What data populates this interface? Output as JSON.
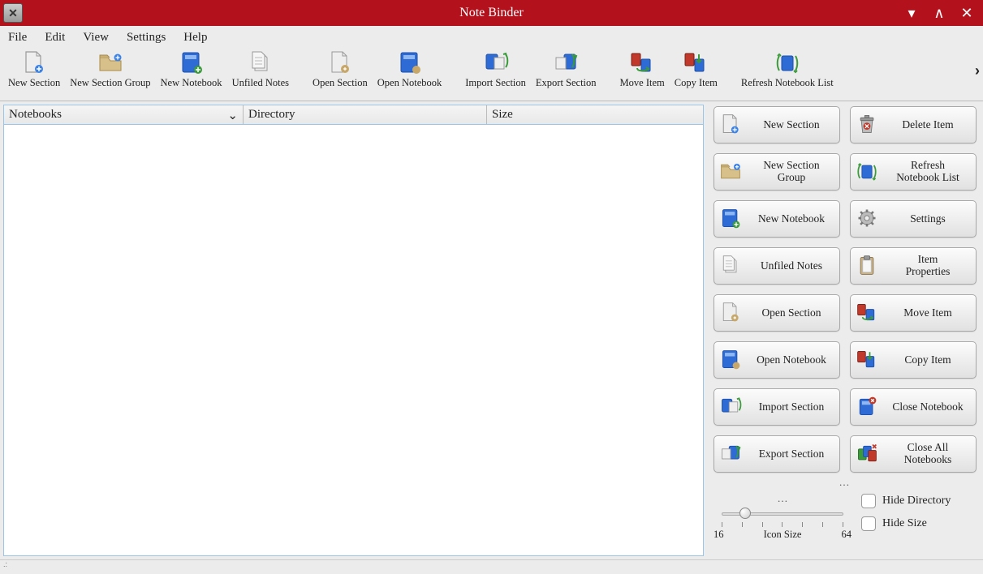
{
  "titlebar": {
    "title": "Note Binder"
  },
  "menubar": [
    "File",
    "Edit",
    "View",
    "Settings",
    "Help"
  ],
  "toolbar": {
    "groups": [
      [
        {
          "id": "new-section",
          "label": "New Section",
          "icon": "file-plus-gray"
        },
        {
          "id": "new-section-group",
          "label": "New Section Group",
          "icon": "folder-plus"
        },
        {
          "id": "new-notebook",
          "label": "New Notebook",
          "icon": "notebook-blue-plus"
        },
        {
          "id": "unfiled-notes",
          "label": "Unfiled Notes",
          "icon": "file-gray-stack"
        }
      ],
      [
        {
          "id": "open-section",
          "label": "Open Section",
          "icon": "file-gray-open"
        },
        {
          "id": "open-notebook",
          "label": "Open Notebook",
          "icon": "notebook-blue-open"
        }
      ],
      [
        {
          "id": "import-section",
          "label": "Import Section",
          "icon": "import-arrow"
        },
        {
          "id": "export-section",
          "label": "Export Section",
          "icon": "export-arrow"
        }
      ],
      [
        {
          "id": "move-item",
          "label": "Move Item",
          "icon": "move-book"
        },
        {
          "id": "copy-item",
          "label": "Copy Item",
          "icon": "copy-book"
        }
      ],
      [
        {
          "id": "refresh-notebook-list",
          "label": "Refresh Notebook List",
          "icon": "refresh-book"
        }
      ]
    ]
  },
  "columns": {
    "c1": "Notebooks",
    "c2": "Directory",
    "c3": "Size"
  },
  "side_buttons": {
    "left": [
      {
        "id": "new-section",
        "label": "New Section",
        "icon": "file-plus-gray"
      },
      {
        "id": "new-section-group",
        "label": "New Section\nGroup",
        "icon": "folder-plus"
      },
      {
        "id": "new-notebook",
        "label": "New Notebook",
        "icon": "notebook-blue-plus"
      },
      {
        "id": "unfiled-notes",
        "label": "Unfiled Notes",
        "icon": "file-gray-stack"
      },
      {
        "id": "open-section",
        "label": "Open Section",
        "icon": "file-gray-open"
      },
      {
        "id": "open-notebook",
        "label": "Open Notebook",
        "icon": "notebook-blue-open"
      },
      {
        "id": "import-section",
        "label": "Import Section",
        "icon": "import-arrow"
      },
      {
        "id": "export-section",
        "label": "Export Section",
        "icon": "export-arrow"
      }
    ],
    "right": [
      {
        "id": "delete-item",
        "label": "Delete Item",
        "icon": "trash"
      },
      {
        "id": "refresh-list",
        "label": "Refresh\nNotebook List",
        "icon": "refresh-book"
      },
      {
        "id": "settings",
        "label": "Settings",
        "icon": "gear"
      },
      {
        "id": "item-props",
        "label": "Item\nProperties",
        "icon": "clipboard"
      },
      {
        "id": "move-item",
        "label": "Move Item",
        "icon": "move-book"
      },
      {
        "id": "copy-item",
        "label": "Copy Item",
        "icon": "copy-book"
      },
      {
        "id": "close-notebook",
        "label": "Close Notebook",
        "icon": "close-book"
      },
      {
        "id": "close-all",
        "label": "Close All\nNotebooks",
        "icon": "close-all-book"
      }
    ]
  },
  "slider": {
    "label": "Icon Size",
    "min": "16",
    "max": "64"
  },
  "checks": {
    "hide_dir": "Hide Directory",
    "hide_size": "Hide Size"
  }
}
